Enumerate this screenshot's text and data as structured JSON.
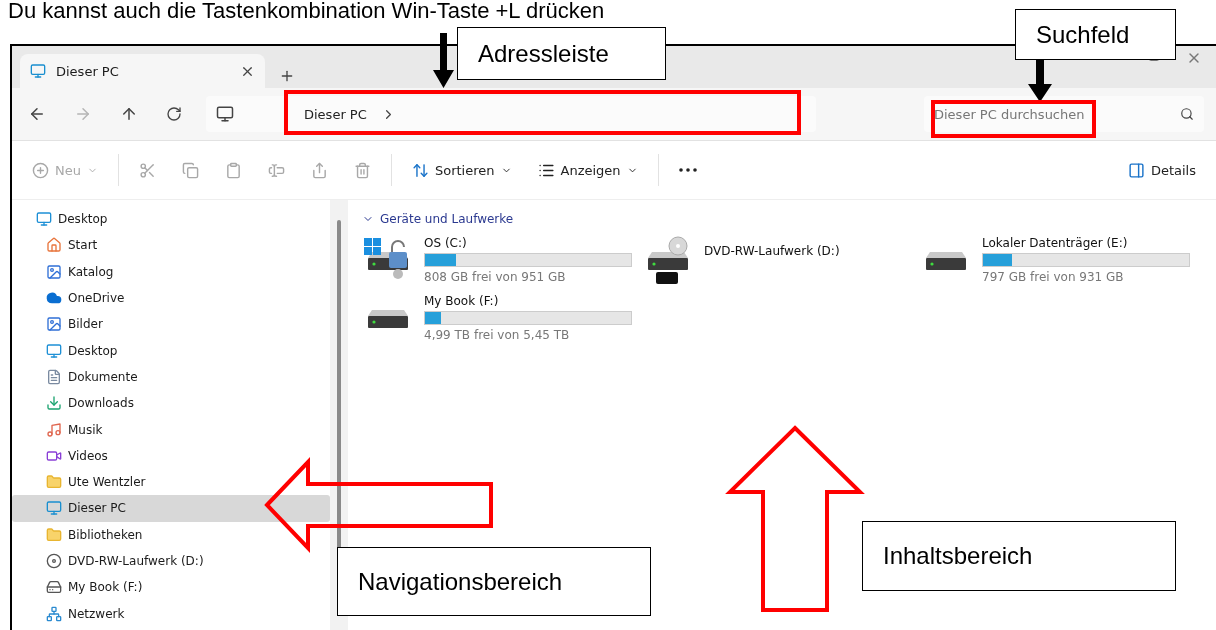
{
  "heading": "Du kannst auch die Tastenkombination Win-Taste +L drücken",
  "window": {
    "tab": {
      "title": "Dieser PC",
      "selected": true
    },
    "address": {
      "crumb": "Dieser PC"
    },
    "search": {
      "placeholder": "Dieser PC durchsuchen"
    }
  },
  "toolbar": {
    "items": [
      {
        "kind": "new",
        "label": "Neu",
        "disabled": true
      },
      {
        "kind": "cut",
        "disabled": true
      },
      {
        "kind": "copy",
        "disabled": true
      },
      {
        "kind": "paste",
        "disabled": true
      },
      {
        "kind": "rename",
        "disabled": true
      },
      {
        "kind": "share",
        "disabled": true
      },
      {
        "kind": "delete",
        "disabled": true
      },
      {
        "kind": "sort",
        "label": "Sortieren",
        "disabled": false
      },
      {
        "kind": "view",
        "label": "Anzeigen",
        "disabled": false
      },
      {
        "kind": "more"
      }
    ],
    "details": "Details"
  },
  "sidebar": {
    "items": [
      {
        "label": "Desktop",
        "kind": "desktop",
        "selected": false,
        "children": [
          {
            "label": "Start",
            "kind": "home",
            "selected": false
          },
          {
            "label": "Katalog",
            "kind": "gallery",
            "selected": false
          },
          {
            "label": "OneDrive",
            "kind": "cloud",
            "selected": false
          },
          {
            "label": "Bilder",
            "kind": "pictures",
            "selected": false
          },
          {
            "label": "Desktop",
            "kind": "desktop",
            "selected": false
          },
          {
            "label": "Dokumente",
            "kind": "documents",
            "selected": false
          },
          {
            "label": "Downloads",
            "kind": "downloads",
            "selected": false
          },
          {
            "label": "Musik",
            "kind": "music",
            "selected": false
          },
          {
            "label": "Videos",
            "kind": "videos",
            "selected": false
          },
          {
            "label": "Ute Wentzler",
            "kind": "folder",
            "selected": false
          },
          {
            "label": "Dieser PC",
            "kind": "pc",
            "selected": true
          },
          {
            "label": "Bibliotheken",
            "kind": "folder",
            "selected": false
          },
          {
            "label": "DVD-RW-Laufwerk (D:)",
            "kind": "dvd",
            "selected": false
          },
          {
            "label": "My Book (F:)",
            "kind": "drive",
            "selected": false
          },
          {
            "label": "Netzwerk",
            "kind": "network",
            "selected": false
          }
        ]
      }
    ]
  },
  "content": {
    "section": {
      "title": "Geräte und Laufwerke",
      "expanded": true
    },
    "drives": [
      {
        "name": "OS (C:)",
        "kind": "system",
        "level": 0.15,
        "free": "808 GB frei von 951 GB"
      },
      {
        "name": "DVD-RW-Laufwerk (D:)",
        "kind": "dvd"
      },
      {
        "name": "Lokaler Datenträger (E:)",
        "kind": "disk",
        "level": 0.14,
        "free": "797 GB frei von 931 GB"
      },
      {
        "name": "My Book (F:)",
        "kind": "disk",
        "level": 0.08,
        "free": "4,99 TB frei von 5,45 TB"
      }
    ]
  },
  "annotations": [
    {
      "kind": "address",
      "label": "Adressleiste"
    },
    {
      "kind": "search",
      "label": "Suchfeld"
    },
    {
      "kind": "navigation",
      "label": "Navigationsbereich"
    },
    {
      "kind": "content",
      "label": "Inhaltsbereich"
    }
  ]
}
